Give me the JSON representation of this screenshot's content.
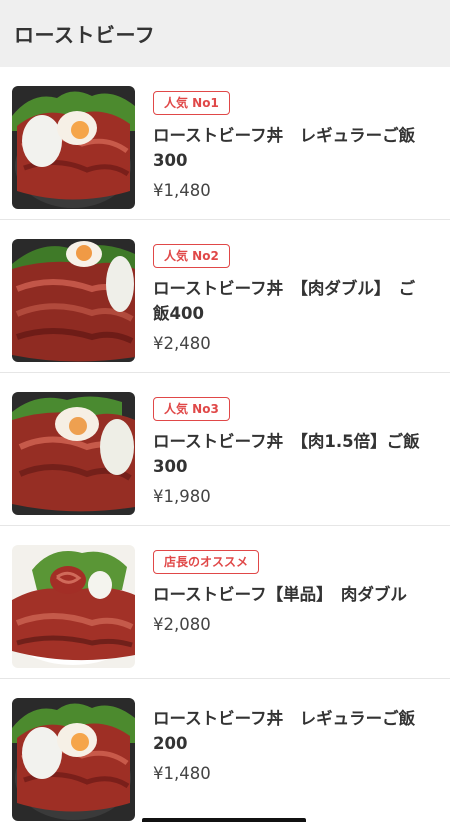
{
  "header": {
    "title": "ローストビーフ"
  },
  "items": [
    {
      "badge": "人気 No1",
      "name": "ローストビーフ丼　レギュラーご飯300",
      "price": "¥1,480"
    },
    {
      "badge": "人気 No2",
      "name": "ローストビーフ丼　【肉ダブル】　ご飯400",
      "price": "¥2,480"
    },
    {
      "badge": "人気 No3",
      "name": "ローストビーフ丼　【肉1.5倍】ご飯300",
      "price": "¥1,980"
    },
    {
      "badge": "店長のオススメ",
      "name": "ローストビーフ【単品】　肉ダブル",
      "price": "¥2,080"
    },
    {
      "badge": "",
      "name": "ローストビーフ丼　レギュラーご飯200",
      "price": "¥1,480"
    }
  ],
  "colors": {
    "accent": "#e04848",
    "header_bg": "#efefef"
  },
  "icons": [
    "roast-beef-bowl-photo",
    "roast-beef-plate-photo"
  ]
}
